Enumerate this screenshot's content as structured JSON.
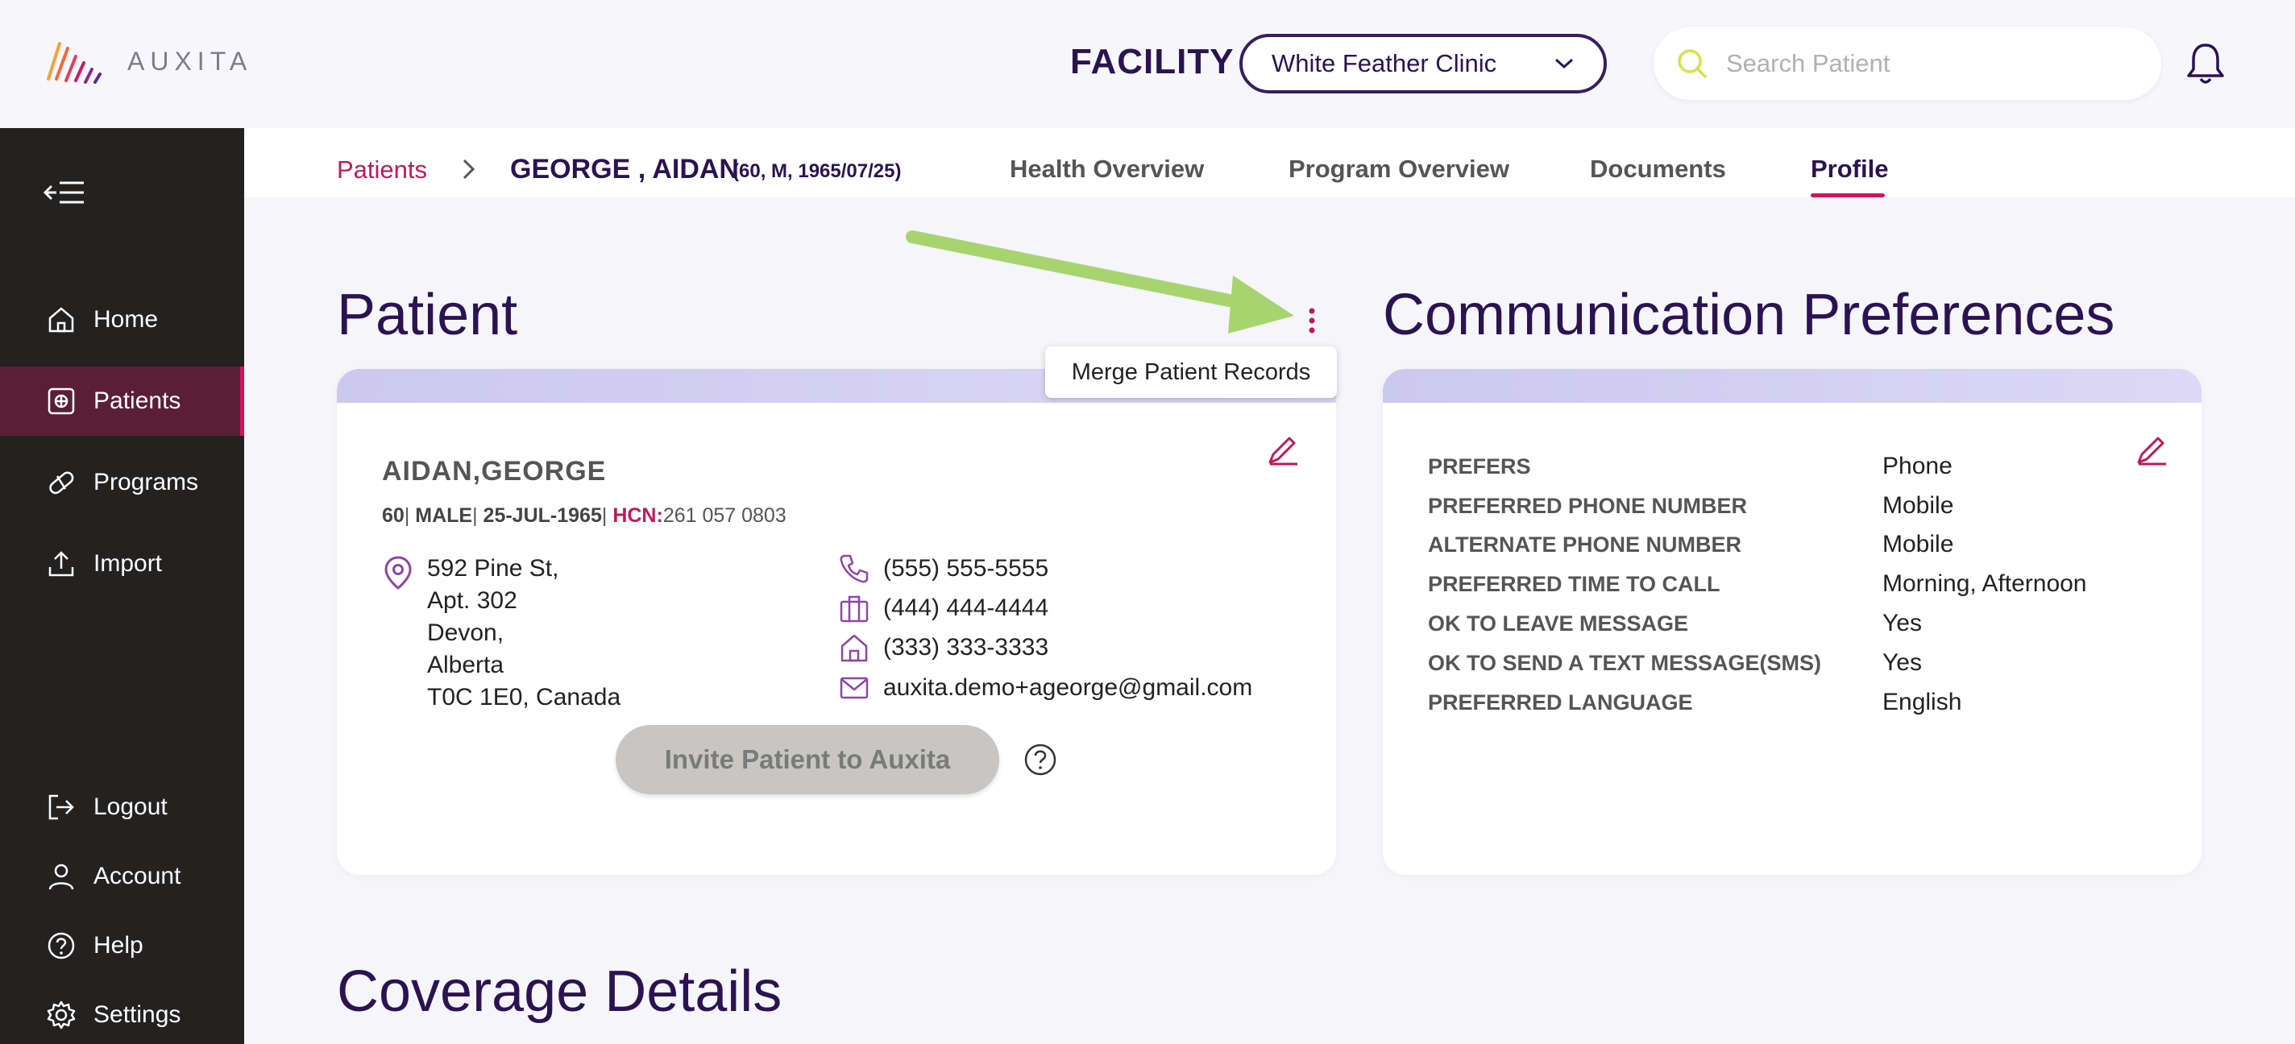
{
  "header": {
    "brand": "AUXITA",
    "facility_label": "FACILITY",
    "facility_value": "White Feather Clinic",
    "search_placeholder": "Search Patient"
  },
  "sidebar": {
    "items": [
      {
        "label": "Home",
        "icon": "home-icon"
      },
      {
        "label": "Patients",
        "icon": "patients-icon",
        "active": true
      },
      {
        "label": "Programs",
        "icon": "pill-icon"
      },
      {
        "label": "Import",
        "icon": "upload-icon"
      },
      {
        "label": "Logout",
        "icon": "logout-icon"
      },
      {
        "label": "Account",
        "icon": "user-icon"
      },
      {
        "label": "Help",
        "icon": "help-icon"
      },
      {
        "label": "Settings",
        "icon": "gear-icon"
      }
    ]
  },
  "breadcrumb": {
    "link": "Patients",
    "name": "GEORGE , AIDAN",
    "sub": "(60, M, 1965/07/25)"
  },
  "tabs": [
    "Health Overview",
    "Program Overview",
    "Documents",
    "Profile"
  ],
  "active_tab": "Profile",
  "patient": {
    "section_title": "Patient",
    "name": "AIDAN,GEORGE",
    "age": "60",
    "sex": "MALE",
    "dob": "25-JUL-1965",
    "hcn_label": "HCN:",
    "hcn": "261 057 0803",
    "address": [
      "592 Pine St,",
      "Apt. 302",
      "Devon,",
      "Alberta",
      "T0C 1E0, Canada"
    ],
    "mobile": "(555) 555-5555",
    "work": "(444) 444-4444",
    "home": "(333) 333-3333",
    "email": "auxita.demo+ageorge@gmail.com",
    "invite_label": "Invite Patient to Auxita",
    "menu_tooltip": "Merge Patient Records"
  },
  "communication": {
    "section_title": "Communication Preferences",
    "rows": [
      {
        "label": "PREFERS",
        "value": "Phone"
      },
      {
        "label": "PREFERRED PHONE NUMBER",
        "value": "Mobile"
      },
      {
        "label": "ALTERNATE PHONE NUMBER",
        "value": "Mobile"
      },
      {
        "label": "PREFERRED TIME TO CALL",
        "value": "Morning, Afternoon"
      },
      {
        "label": "OK TO LEAVE MESSAGE",
        "value": "Yes"
      },
      {
        "label": "OK TO SEND A TEXT MESSAGE(SMS)",
        "value": "Yes"
      },
      {
        "label": "PREFERRED LANGUAGE",
        "value": "English"
      }
    ]
  },
  "coverage": {
    "section_title": "Coverage Details"
  },
  "colors": {
    "primary": "#2b1352",
    "accent": "#d4145a",
    "sidebar": "#242121",
    "arrow": "#a8d46f"
  }
}
